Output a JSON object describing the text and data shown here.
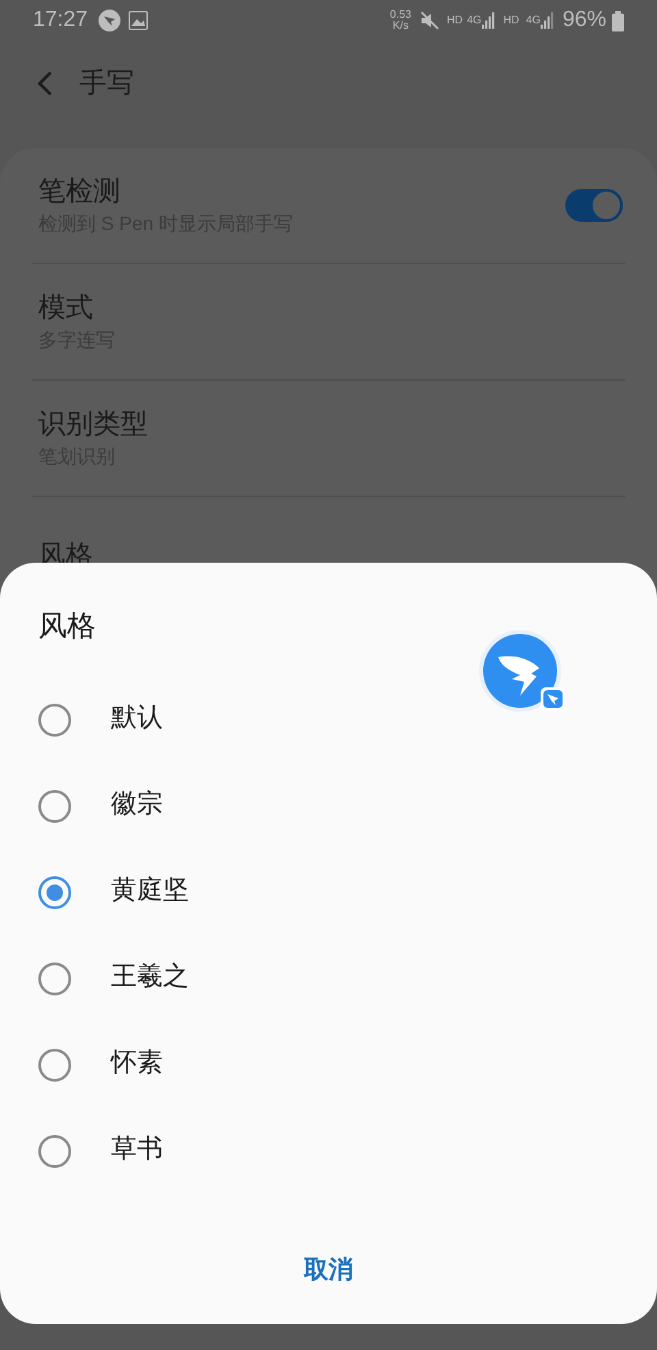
{
  "status_bar": {
    "time": "17:27",
    "speed_value": "0.53",
    "speed_unit": "K/s",
    "sim1_hd": "HD",
    "sim1_network": "4G",
    "sim2_hd": "HD",
    "sim2_network": "4G",
    "battery": "96%"
  },
  "header": {
    "title": "手写"
  },
  "settings": [
    {
      "kind": "toggle",
      "title": "笔检测",
      "subtitle": "检测到 S Pen 时显示局部手写",
      "on": true
    },
    {
      "kind": "text",
      "title": "模式",
      "subtitle": "多字连写"
    },
    {
      "kind": "text",
      "title": "识别类型",
      "subtitle": "笔划识别"
    },
    {
      "kind": "text",
      "title": "风格"
    }
  ],
  "dialog": {
    "title": "风格",
    "options": [
      {
        "label": "默认",
        "selected": false
      },
      {
        "label": "徽宗",
        "selected": false
      },
      {
        "label": "黄庭坚",
        "selected": true
      },
      {
        "label": "王羲之",
        "selected": false
      },
      {
        "label": "怀素",
        "selected": false
      },
      {
        "label": "草书",
        "selected": false
      }
    ],
    "cancel": "取消"
  }
}
